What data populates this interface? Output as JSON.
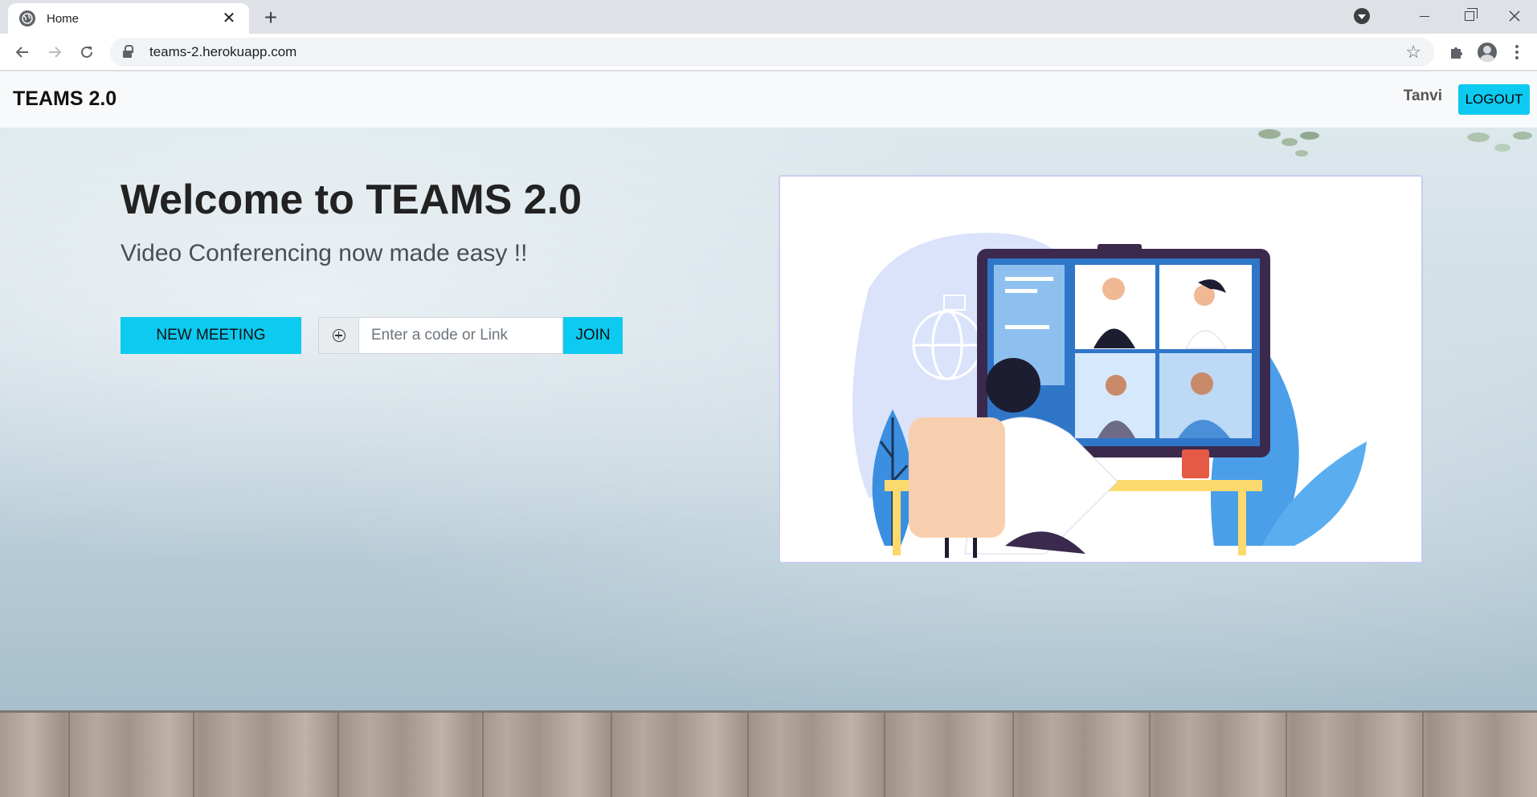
{
  "browser": {
    "tab_title": "Home",
    "tab_close": "✕",
    "new_tab": "+",
    "url": "teams-2.herokuapp.com",
    "icons": [
      "globe-icon",
      "close-icon",
      "plus-icon",
      "back-icon",
      "forward-icon",
      "reload-icon",
      "lock-icon",
      "star-icon",
      "puzzle-icon",
      "profile-icon",
      "menu-icon",
      "minimize-icon",
      "restore-icon"
    ]
  },
  "navbar": {
    "brand": "TEAMS 2.0",
    "user": "Tanvi",
    "logout_label": "LOGOUT"
  },
  "hero": {
    "title_prefix": "Welcome to ",
    "title_bold": "TEAMS 2.0",
    "subtitle": "Video Conferencing now made easy !!"
  },
  "actions": {
    "new_meeting_label": "NEW MEETING",
    "code_placeholder": "Enter a code or Link",
    "join_label": "JOIN"
  },
  "colors": {
    "accent": "#0dcaf0",
    "navbar_bg": "#f8f9fa"
  }
}
